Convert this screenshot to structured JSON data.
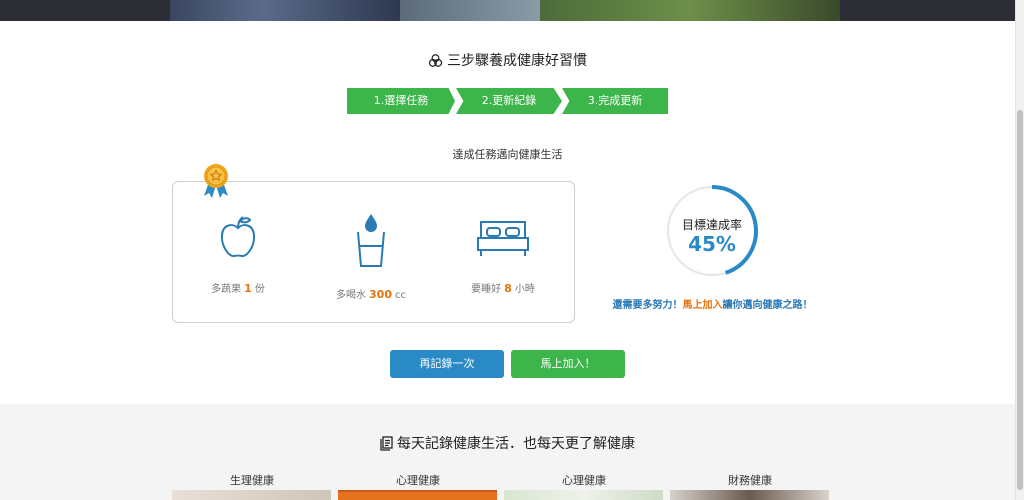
{
  "section1": {
    "title": "三步驟養成健康好習慣",
    "steps": [
      "1.選擇任務",
      "2.更新紀錄",
      "3.完成更新"
    ],
    "subtitle": "達成任務邁向健康生活"
  },
  "tasks": [
    {
      "icon": "apple-icon",
      "prefix": "多蔬果",
      "value": "1",
      "unit": "份"
    },
    {
      "icon": "water-glass-icon",
      "prefix": "多喝水",
      "value": "300",
      "unit": "cc"
    },
    {
      "icon": "bed-icon",
      "prefix": "要睡好",
      "value": "8",
      "unit": "小時"
    }
  ],
  "gauge": {
    "title": "目標達成率",
    "value_text": "45%",
    "progress": 0.45,
    "color": "#2a8ac6"
  },
  "encourage": {
    "part1": "還需要多努力！",
    "highlight": "馬上加入",
    "part2": "讓你邁向健康之路！"
  },
  "buttons": {
    "again": "再記錄一次",
    "join": "馬上加入！"
  },
  "section2": {
    "title": "每天記錄健康生活．也每天更了解健康",
    "categories": [
      "生理健康",
      "心理健康",
      "心理健康",
      "財務健康"
    ]
  },
  "colors": {
    "green": "#3cb54a",
    "blue": "#2a8ac6",
    "orange": "#e8720c"
  }
}
